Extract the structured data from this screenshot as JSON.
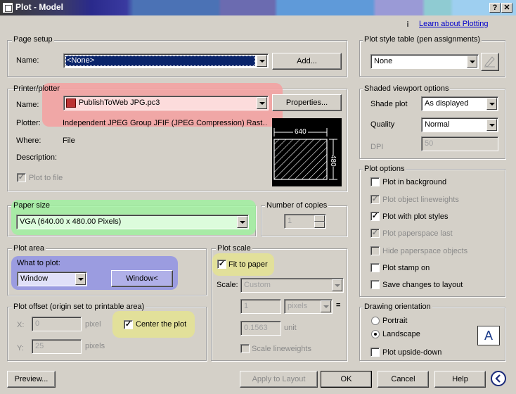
{
  "window": {
    "title": "Plot - Model",
    "help_btn": "?",
    "close_btn": "✕"
  },
  "learn_link": "Learn about Plotting",
  "page_setup": {
    "label": "Page setup",
    "name_label": "Name:",
    "name_value": "<None>",
    "add_button": "Add..."
  },
  "printer": {
    "label": "Printer/plotter",
    "name_label": "Name:",
    "name_value": "PublishToWeb JPG.pc3",
    "properties_button": "Properties...",
    "plotter_label": "Plotter:",
    "plotter_value": "Independent JPEG Group JFIF (JPEG Compression) Rast…",
    "where_label": "Where:",
    "where_value": "File",
    "description_label": "Description:",
    "plot_to_file_label": "Plot to file",
    "preview_width": "640",
    "preview_height": "480"
  },
  "paper_size": {
    "label": "Paper size",
    "value": "VGA (640.00 x 480.00 Pixels)"
  },
  "copies": {
    "label": "Number of copies",
    "value": "1"
  },
  "plot_area": {
    "label": "Plot area",
    "what_label": "What to plot:",
    "what_value": "Window",
    "window_button": "Window<"
  },
  "plot_offset": {
    "label": "Plot offset (origin set to printable area)",
    "x_label": "X:",
    "x_value": "0",
    "x_unit": "pixel",
    "y_label": "Y:",
    "y_value": "25",
    "y_unit": "pixels",
    "center_label": "Center the plot"
  },
  "plot_scale": {
    "label": "Plot scale",
    "fit_label": "Fit to paper",
    "scale_label": "Scale:",
    "scale_value": "Custom",
    "num_value": "1",
    "unit_value": "pixels",
    "equals": "=",
    "den_value": "0.1563",
    "den_unit": "unit",
    "lineweights_label": "Scale lineweights"
  },
  "plot_style_table": {
    "label": "Plot style table (pen assignments)",
    "value": "None"
  },
  "shaded": {
    "label": "Shaded viewport options",
    "shade_label": "Shade plot",
    "shade_value": "As displayed",
    "quality_label": "Quality",
    "quality_value": "Normal",
    "dpi_label": "DPI",
    "dpi_value": "50"
  },
  "plot_options": {
    "label": "Plot options",
    "items": [
      {
        "label": "Plot in background",
        "checked": false,
        "enabled": true
      },
      {
        "label": "Plot object lineweights",
        "checked": true,
        "enabled": false
      },
      {
        "label": "Plot with plot styles",
        "checked": true,
        "enabled": true
      },
      {
        "label": "Plot paperspace last",
        "checked": true,
        "enabled": false
      },
      {
        "label": "Hide paperspace objects",
        "checked": false,
        "enabled": false
      },
      {
        "label": "Plot stamp on",
        "checked": false,
        "enabled": true
      },
      {
        "label": "Save changes to layout",
        "checked": false,
        "enabled": true
      }
    ]
  },
  "orientation": {
    "label": "Drawing orientation",
    "portrait": "Portrait",
    "landscape": "Landscape",
    "upside_down": "Plot upside-down",
    "icon_letter": "A"
  },
  "footer": {
    "preview": "Preview...",
    "apply": "Apply to Layout",
    "ok": "OK",
    "cancel": "Cancel",
    "help": "Help"
  },
  "highlights": {
    "printer": "#f5a0a0",
    "paper": "#a0f0a0",
    "plot_area": "#9b9ce0",
    "fit": "#e2e09a",
    "center": "#e2e09a"
  }
}
